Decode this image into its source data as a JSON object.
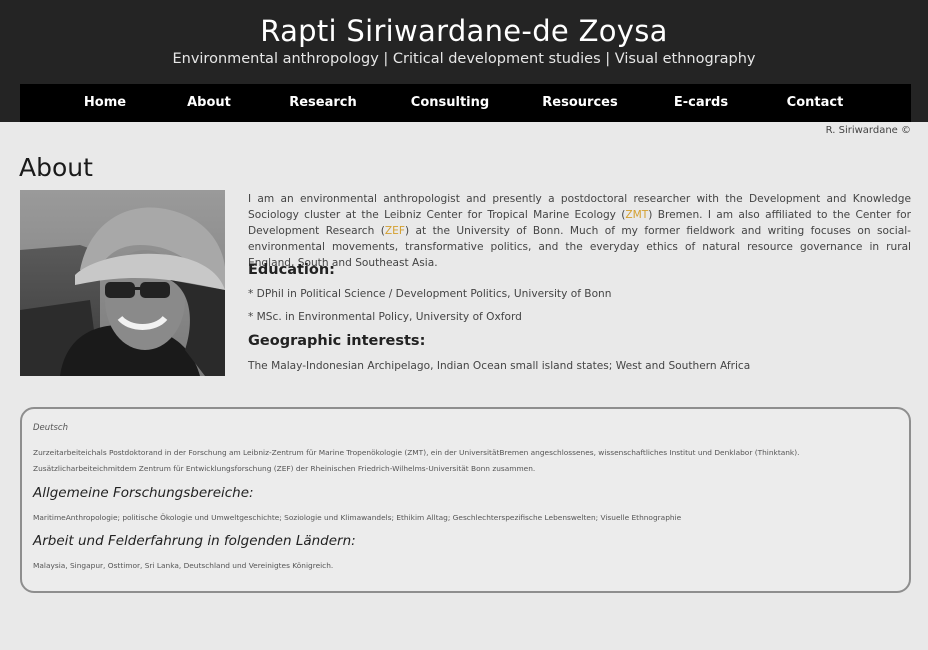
{
  "header": {
    "title": "Rapti Siriwardane-de Zoysa",
    "subtitle": "Environmental anthropology | Critical development studies | Visual ethnography"
  },
  "nav": {
    "items": [
      "Home",
      "About",
      "Research",
      "Consulting",
      "Resources",
      "E-cards",
      "Contact"
    ]
  },
  "copyright": "R. Siriwardane ©",
  "page": {
    "title": "About"
  },
  "about": {
    "intro_1": "I am an environmental anthropologist and presently a postdoctoral researcher with the Development and Knowledge Sociology cluster at the Leibniz Center for Tropical Marine Ecology (",
    "link_zmt": "ZMT",
    "intro_2": ") Bremen. I am also affiliated to the Center for Development Research (",
    "link_zef": "ZEF",
    "intro_3": ") at the University of Bonn. Much of my former fieldwork and writing focuses on social-environmental movements, transformative politics, and the everyday ethics of natural resource governance in rural England, South and Southeast Asia.",
    "education_heading": "Education:",
    "education": [
      "* DPhil in Political Science / Development Politics, University of Bonn",
      "* MSc. in Environmental Policy, University of Oxford"
    ],
    "geo_heading": "Geographic interests:",
    "geo_text": "The Malay-Indonesian Archipelago, Indian Ocean small island states; West and Southern Africa"
  },
  "deutsch": {
    "lang_label": "Deutsch",
    "para_line1": "Zurzeitarbeiteichals Postdoktorand in der Forschung am Leibniz-Zentrum für Marine Tropenökologie (ZMT), ein der UniversitätBremen angeschlossenes, wissenschaftliches Institut und Denklabor (Thinktank).",
    "para_line2": "Zusätzlicharbeiteichmitdem Zentrum für Entwicklungsforschung (ZEF) der Rheinischen Friedrich-Wilhelms-Universität Bonn zusammen.",
    "heading_research": "Allgemeine Forschungsbereiche:",
    "research_text": "MaritimeAnthropologie; politische Ökologie und Umweltgeschichte; Soziologie und Klimawandels; Ethikim Alltag; Geschlechterspezifische Lebenswelten; Visuelle Ethnographie",
    "heading_countries": "Arbeit und Felderfahrung in folgenden Ländern:",
    "countries_text": "Malaysia, Singapur, Osttimor, Sri Lanka, Deutschland und Vereinigtes Königreich."
  }
}
